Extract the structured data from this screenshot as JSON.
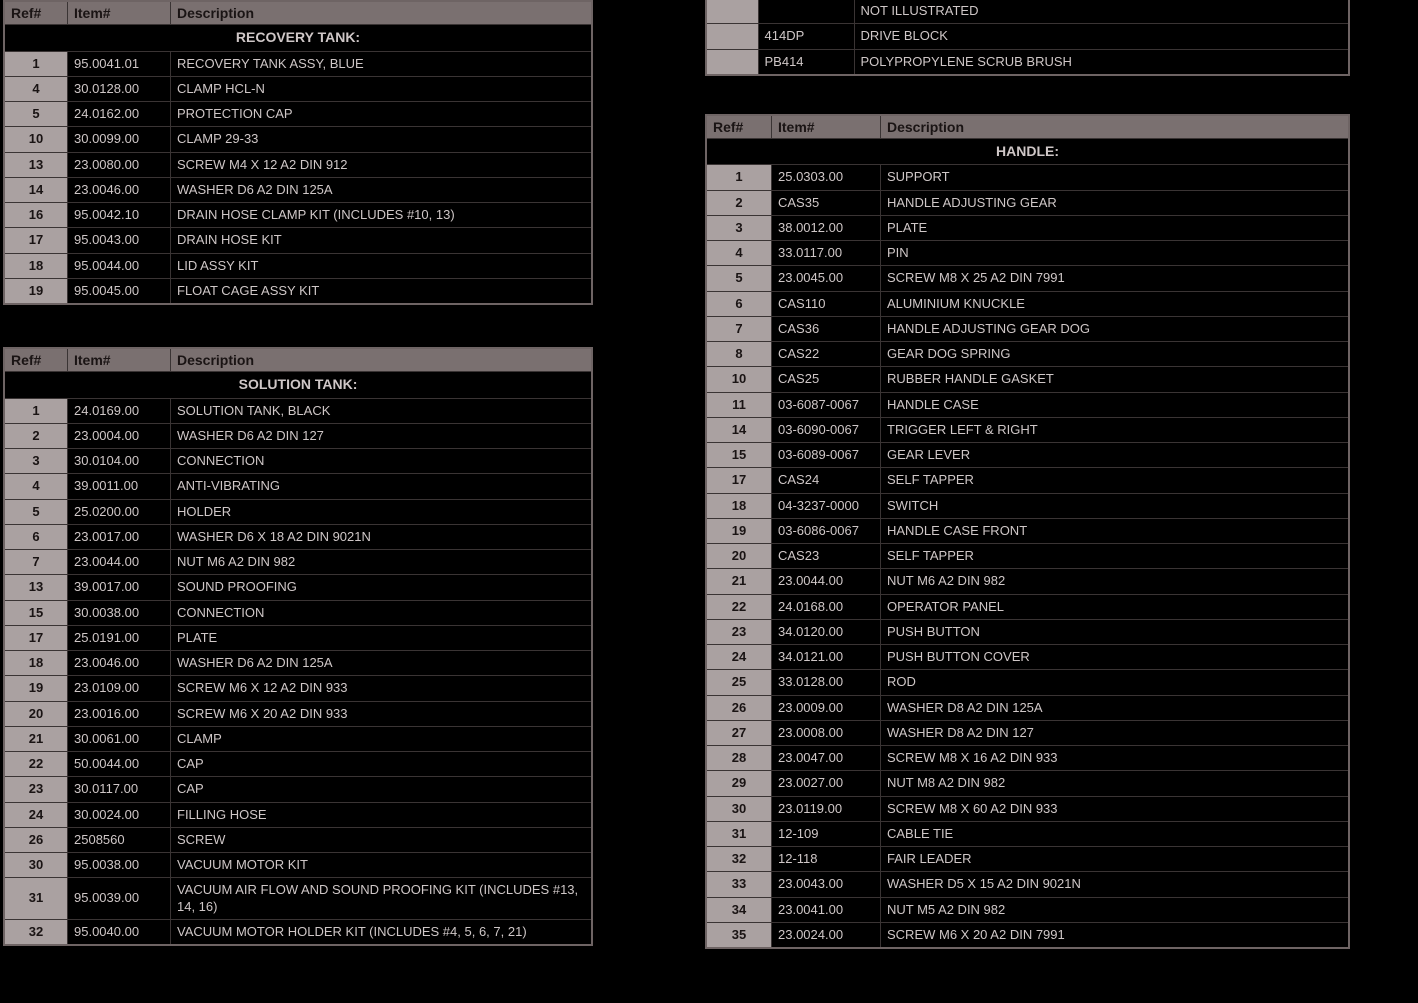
{
  "headers": {
    "ref": "Ref#",
    "item": "Item#",
    "desc": "Description"
  },
  "fragment_rows": [
    {
      "ref": "",
      "item": "",
      "desc": "NOT ILLUSTRATED"
    },
    {
      "ref": "",
      "item": "414DP",
      "desc": "DRIVE BLOCK"
    },
    {
      "ref": "",
      "item": "PB414",
      "desc": "POLYPROPYLENE SCRUB BRUSH"
    }
  ],
  "tables": {
    "recovery_tank": {
      "title": "RECOVERY TANK:",
      "rows": [
        {
          "ref": "1",
          "item": "95.0041.01",
          "desc": "RECOVERY TANK ASSY, BLUE"
        },
        {
          "ref": "4",
          "item": "30.0128.00",
          "desc": "CLAMP HCL-N"
        },
        {
          "ref": "5",
          "item": "24.0162.00",
          "desc": "PROTECTION CAP"
        },
        {
          "ref": "10",
          "item": "30.0099.00",
          "desc": "CLAMP 29-33"
        },
        {
          "ref": "13",
          "item": "23.0080.00",
          "desc": "SCREW M4 X 12 A2 DIN 912"
        },
        {
          "ref": "14",
          "item": "23.0046.00",
          "desc": "WASHER D6 A2 DIN 125A"
        },
        {
          "ref": "16",
          "item": "95.0042.10",
          "desc": "DRAIN HOSE CLAMP KIT (INCLUDES #10, 13)"
        },
        {
          "ref": "17",
          "item": "95.0043.00",
          "desc": "DRAIN HOSE KIT"
        },
        {
          "ref": "18",
          "item": "95.0044.00",
          "desc": "LID ASSY KIT"
        },
        {
          "ref": "19",
          "item": "95.0045.00",
          "desc": "FLOAT CAGE ASSY KIT"
        }
      ]
    },
    "solution_tank": {
      "title": "SOLUTION TANK:",
      "rows": [
        {
          "ref": "1",
          "item": "24.0169.00",
          "desc": "SOLUTION TANK, BLACK"
        },
        {
          "ref": "2",
          "item": "23.0004.00",
          "desc": "WASHER D6 A2 DIN 127"
        },
        {
          "ref": "3",
          "item": "30.0104.00",
          "desc": "CONNECTION"
        },
        {
          "ref": "4",
          "item": "39.0011.00",
          "desc": "ANTI-VIBRATING"
        },
        {
          "ref": "5",
          "item": "25.0200.00",
          "desc": "HOLDER"
        },
        {
          "ref": "6",
          "item": "23.0017.00",
          "desc": "WASHER D6 X 18 A2 DIN 9021N"
        },
        {
          "ref": "7",
          "item": "23.0044.00",
          "desc": "NUT M6 A2 DIN 982"
        },
        {
          "ref": "13",
          "item": "39.0017.00",
          "desc": "SOUND PROOFING"
        },
        {
          "ref": "15",
          "item": "30.0038.00",
          "desc": "CONNECTION"
        },
        {
          "ref": "17",
          "item": "25.0191.00",
          "desc": "PLATE"
        },
        {
          "ref": "18",
          "item": "23.0046.00",
          "desc": "WASHER D6 A2 DIN 125A"
        },
        {
          "ref": "19",
          "item": "23.0109.00",
          "desc": "SCREW M6 X 12 A2 DIN 933"
        },
        {
          "ref": "20",
          "item": "23.0016.00",
          "desc": "SCREW M6 X 20 A2 DIN 933"
        },
        {
          "ref": "21",
          "item": "30.0061.00",
          "desc": "CLAMP"
        },
        {
          "ref": "22",
          "item": "50.0044.00",
          "desc": "CAP"
        },
        {
          "ref": "23",
          "item": "30.0117.00",
          "desc": "CAP"
        },
        {
          "ref": "24",
          "item": "30.0024.00",
          "desc": "FILLING HOSE"
        },
        {
          "ref": "26",
          "item": "2508560",
          "desc": "SCREW"
        },
        {
          "ref": "30",
          "item": "95.0038.00",
          "desc": "VACUUM MOTOR KIT"
        },
        {
          "ref": "31",
          "item": "95.0039.00",
          "desc": "VACUUM AIR FLOW AND SOUND PROOFING KIT (INCLUDES #13, 14, 16)"
        },
        {
          "ref": "32",
          "item": "95.0040.00",
          "desc": "VACUUM MOTOR HOLDER KIT (INCLUDES #4, 5, 6, 7, 21)"
        }
      ]
    },
    "handle": {
      "title": "HANDLE:",
      "rows": [
        {
          "ref": "1",
          "item": "25.0303.00",
          "desc": "SUPPORT"
        },
        {
          "ref": "2",
          "item": "CAS35",
          "desc": "HANDLE ADJUSTING GEAR"
        },
        {
          "ref": "3",
          "item": "38.0012.00",
          "desc": "PLATE"
        },
        {
          "ref": "4",
          "item": "33.0117.00",
          "desc": "PIN"
        },
        {
          "ref": "5",
          "item": "23.0045.00",
          "desc": "SCREW M8 X 25 A2 DIN 7991"
        },
        {
          "ref": "6",
          "item": "CAS110",
          "desc": "ALUMINIUM KNUCKLE"
        },
        {
          "ref": "7",
          "item": "CAS36",
          "desc": "HANDLE ADJUSTING GEAR DOG"
        },
        {
          "ref": "8",
          "item": "CAS22",
          "desc": "GEAR DOG SPRING"
        },
        {
          "ref": "10",
          "item": "CAS25",
          "desc": "RUBBER HANDLE GASKET"
        },
        {
          "ref": "11",
          "item": "03-6087-0067",
          "desc": "HANDLE CASE"
        },
        {
          "ref": "14",
          "item": "03-6090-0067",
          "desc": "TRIGGER LEFT & RIGHT"
        },
        {
          "ref": "15",
          "item": "03-6089-0067",
          "desc": "GEAR LEVER"
        },
        {
          "ref": "17",
          "item": "CAS24",
          "desc": "SELF TAPPER"
        },
        {
          "ref": "18",
          "item": "04-3237-0000",
          "desc": "SWITCH"
        },
        {
          "ref": "19",
          "item": "03-6086-0067",
          "desc": "HANDLE CASE FRONT"
        },
        {
          "ref": "20",
          "item": "CAS23",
          "desc": "SELF TAPPER"
        },
        {
          "ref": "21",
          "item": "23.0044.00",
          "desc": "NUT M6 A2 DIN 982"
        },
        {
          "ref": "22",
          "item": "24.0168.00",
          "desc": "OPERATOR PANEL"
        },
        {
          "ref": "23",
          "item": "34.0120.00",
          "desc": "PUSH BUTTON"
        },
        {
          "ref": "24",
          "item": "34.0121.00",
          "desc": "PUSH BUTTON COVER"
        },
        {
          "ref": "25",
          "item": "33.0128.00",
          "desc": "ROD"
        },
        {
          "ref": "26",
          "item": "23.0009.00",
          "desc": "WASHER D8 A2 DIN 125A"
        },
        {
          "ref": "27",
          "item": "23.0008.00",
          "desc": "WASHER D8 A2 DIN 127"
        },
        {
          "ref": "28",
          "item": "23.0047.00",
          "desc": "SCREW M8 X 16 A2 DIN 933"
        },
        {
          "ref": "29",
          "item": "23.0027.00",
          "desc": "NUT M8 A2 DIN 982"
        },
        {
          "ref": "30",
          "item": "23.0119.00",
          "desc": "SCREW M8 X 60 A2 DIN 933"
        },
        {
          "ref": "31",
          "item": "12-109",
          "desc": "CABLE TIE"
        },
        {
          "ref": "32",
          "item": "12-118",
          "desc": "FAIR LEADER"
        },
        {
          "ref": "33",
          "item": "23.0043.00",
          "desc": "WASHER D5 X 15 A2 DIN 9021N"
        },
        {
          "ref": "34",
          "item": "23.0041.00",
          "desc": "NUT M5 A2 DIN 982"
        },
        {
          "ref": "35",
          "item": "23.0024.00",
          "desc": "SCREW M6 X 20 A2 DIN 7991"
        }
      ]
    }
  }
}
